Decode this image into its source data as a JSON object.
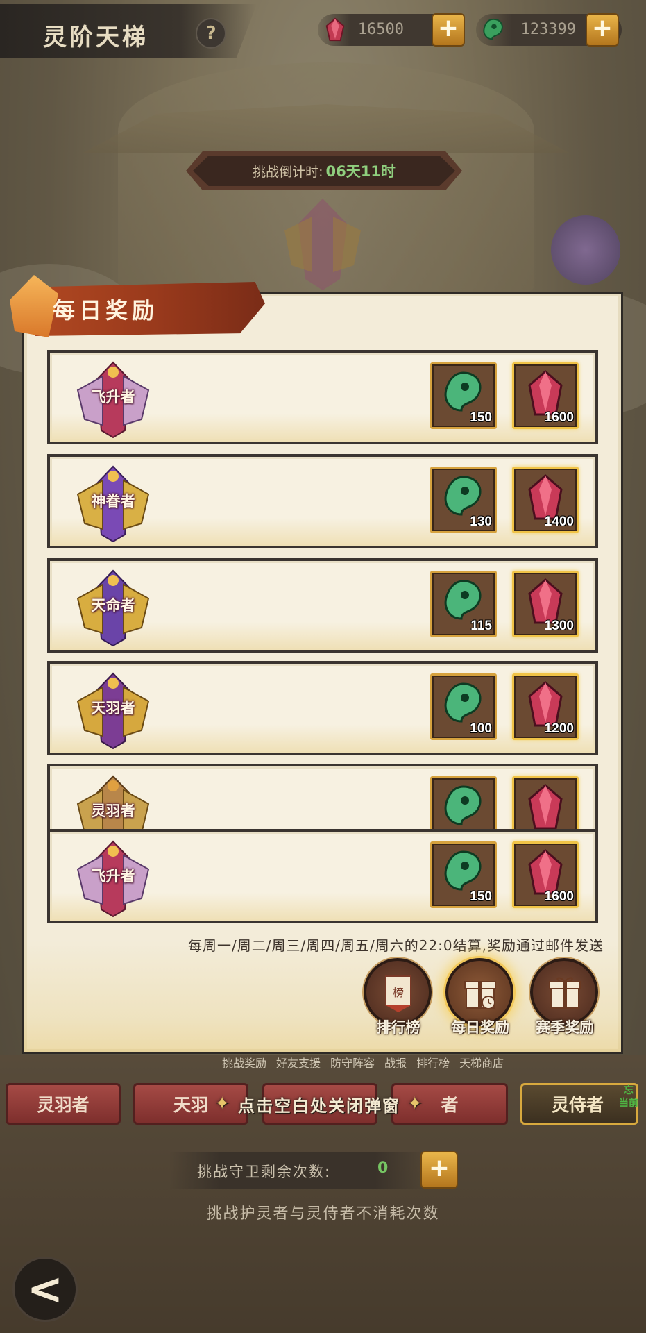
{
  "header": {
    "title": "灵阶天梯",
    "help_label": "?"
  },
  "currencies": [
    {
      "icon": "red-crystal-icon",
      "amount": "16500",
      "plus": "+"
    },
    {
      "icon": "jade-icon",
      "amount": "123399",
      "plus": "+"
    }
  ],
  "countdown": {
    "label": "挑战倒计时:",
    "value": "06天11时"
  },
  "modal": {
    "title": "每日奖励",
    "rows": [
      {
        "tier": "飞升者",
        "rewards": [
          {
            "icon": "jade-icon",
            "qty": "150"
          },
          {
            "icon": "red-crystal-icon",
            "qty": "1600"
          }
        ]
      },
      {
        "tier": "神眷者",
        "rewards": [
          {
            "icon": "jade-icon",
            "qty": "130"
          },
          {
            "icon": "red-crystal-icon",
            "qty": "1400"
          }
        ]
      },
      {
        "tier": "天命者",
        "rewards": [
          {
            "icon": "jade-icon",
            "qty": "115"
          },
          {
            "icon": "red-crystal-icon",
            "qty": "1300"
          }
        ]
      },
      {
        "tier": "天羽者",
        "rewards": [
          {
            "icon": "jade-icon",
            "qty": "100"
          },
          {
            "icon": "red-crystal-icon",
            "qty": "1200"
          }
        ]
      },
      {
        "tier": "灵羽者",
        "rewards": [
          {
            "icon": "jade-icon",
            "qty": ""
          },
          {
            "icon": "red-crystal-icon",
            "qty": ""
          }
        ]
      },
      {
        "tier": "飞升者",
        "rewards": [
          {
            "icon": "jade-icon",
            "qty": "150"
          },
          {
            "icon": "red-crystal-icon",
            "qty": "1600"
          }
        ]
      }
    ],
    "footnote": "每周一/周二/周三/周四/周五/周六的22:0结算,奖励通过邮件发送",
    "buttons": [
      {
        "icon": "ranking-banner-icon",
        "label": "排行榜"
      },
      {
        "icon": "daily-gift-clock-icon",
        "label": "每日奖励"
      },
      {
        "icon": "gift-box-icon",
        "label": "赛季奖励"
      }
    ]
  },
  "bottom_nav": [
    "挑战奖励",
    "好友支援",
    "防守阵容",
    "战报",
    "排行榜",
    "天梯商店"
  ],
  "tier_tabs": [
    "灵羽者",
    "天羽",
    "",
    "者",
    "灵侍者"
  ],
  "tag_badge": "忘\n当前",
  "close_hint": "点击空白处关闭弹窗",
  "guard": {
    "label": "挑战守卫剩余次数:",
    "count": "0",
    "plus": "+",
    "note": "挑战护灵者与灵侍者不消耗次数"
  },
  "back_label": "<",
  "colors": {
    "accent_gold": "#d6a23e",
    "banner_red": "#b34a22",
    "count_green": "#8fcf7e"
  }
}
